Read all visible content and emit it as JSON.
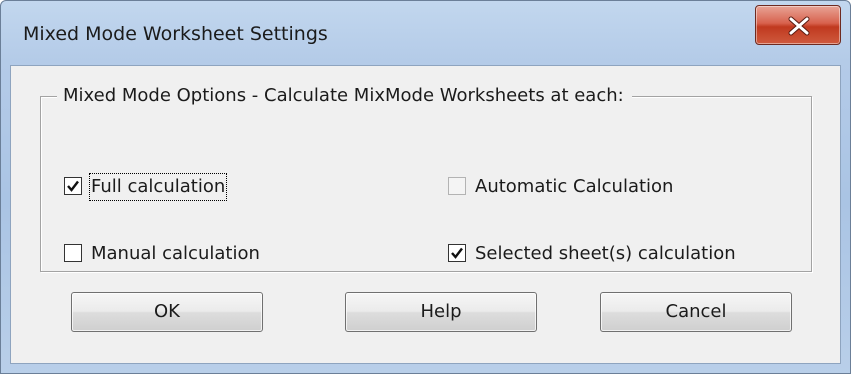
{
  "window": {
    "title": "Mixed Mode Worksheet Settings"
  },
  "group": {
    "legend": "Mixed Mode Options - Calculate MixMode Worksheets at each:"
  },
  "options": {
    "full": {
      "label": "Full calculation",
      "checked": true,
      "enabled": true
    },
    "manual": {
      "label": "Manual calculation",
      "checked": false,
      "enabled": true
    },
    "automatic": {
      "label": "Automatic Calculation",
      "checked": false,
      "enabled": false
    },
    "selected": {
      "label": "Selected sheet(s) calculation",
      "checked": true,
      "enabled": true
    }
  },
  "buttons": {
    "ok": "OK",
    "help": "Help",
    "cancel": "Cancel"
  },
  "icons": {
    "close": "close-x-icon",
    "check": "checkmark-icon"
  },
  "colors": {
    "close_button": "#c9452a",
    "dialog_background": "#f0f0f0",
    "frame": "#b4cbe8"
  }
}
